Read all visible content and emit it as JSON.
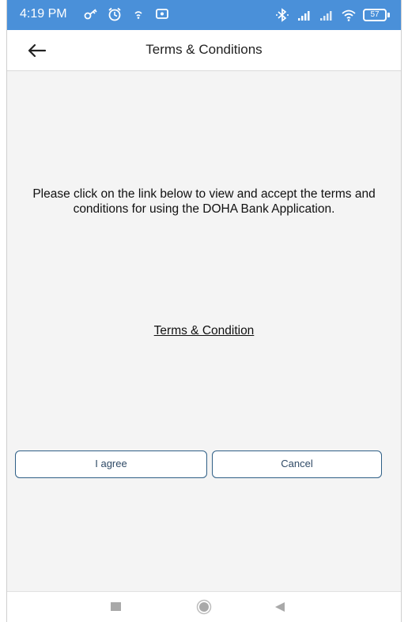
{
  "status_bar": {
    "time": "4:19 PM",
    "battery_level": "57",
    "left_icons": [
      "vpn-key-icon",
      "alarm-icon",
      "wifi-calling-icon",
      "screen-cast-icon"
    ],
    "right_icons": [
      "bluetooth-icon",
      "signal-icon",
      "signal-roaming-icon",
      "wifi-icon",
      "battery-icon"
    ],
    "background_color": "#4a90d9"
  },
  "app_bar": {
    "back_icon": "arrow-left-icon",
    "title": "Terms & Conditions"
  },
  "content": {
    "intro_text": "Please click on the link below to view and accept the terms and conditions for using the DOHA Bank Application.",
    "terms_link": "Terms & Condition"
  },
  "actions": {
    "agree_label": "I agree",
    "cancel_label": "Cancel",
    "border_color": "#2f5f86"
  },
  "nav_bar": {
    "icons": [
      "recent-apps-icon",
      "home-icon",
      "back-triangle-icon"
    ]
  }
}
